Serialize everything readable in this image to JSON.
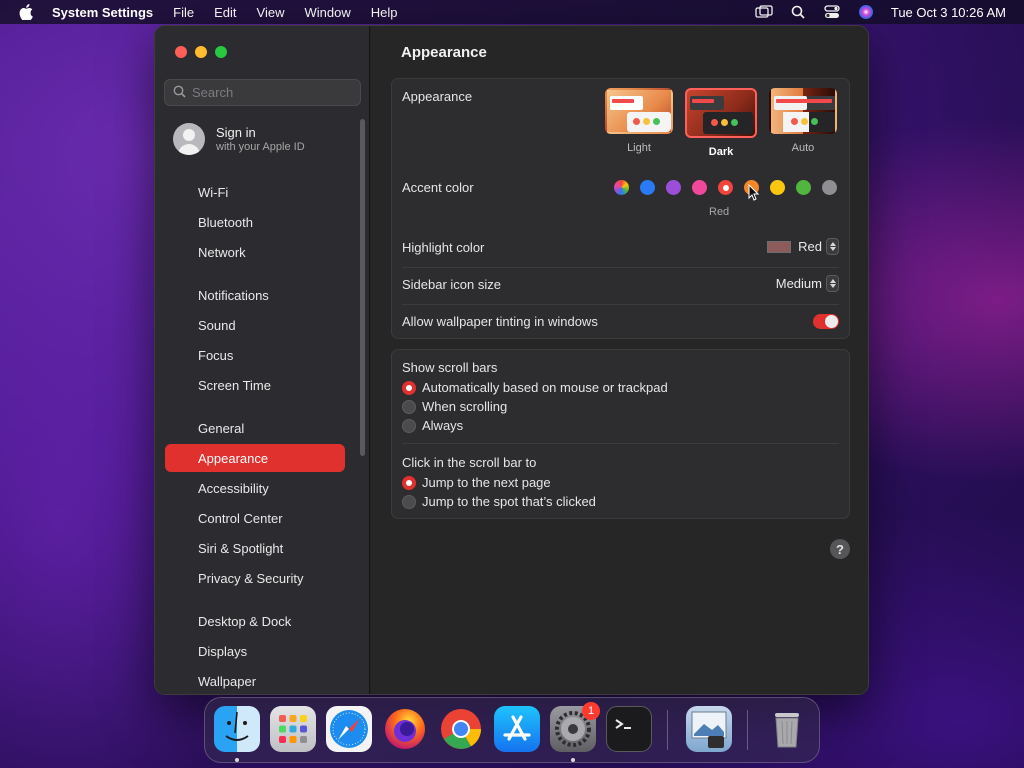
{
  "menubar": {
    "app_name": "System Settings",
    "items": [
      "File",
      "Edit",
      "View",
      "Window",
      "Help"
    ],
    "clock": "Tue Oct 3   10:26 AM"
  },
  "sidebar": {
    "search_placeholder": "Search",
    "signin_title": "Sign in",
    "signin_subtitle": "with your Apple ID",
    "items": [
      {
        "label": "Wi-Fi",
        "icon": "wifi-icon",
        "color": "#2f7cf6"
      },
      {
        "label": "Bluetooth",
        "icon": "bluetooth-icon",
        "color": "#2f7cf6"
      },
      {
        "label": "Network",
        "icon": "globe-icon",
        "color": "#2f7cf6"
      },
      {
        "label": "Notifications",
        "icon": "bell-icon",
        "color": "#ef3b3b"
      },
      {
        "label": "Sound",
        "icon": "speaker-icon",
        "color": "#ef3b6b"
      },
      {
        "label": "Focus",
        "icon": "moon-icon",
        "color": "#6a4cd8"
      },
      {
        "label": "Screen Time",
        "icon": "hourglass-icon",
        "color": "#6a4cd8"
      },
      {
        "label": "General",
        "icon": "gear-icon",
        "color": "#8e8e93"
      },
      {
        "label": "Appearance",
        "icon": "appearance-icon",
        "color": "#1c1c1e"
      },
      {
        "label": "Accessibility",
        "icon": "accessibility-icon",
        "color": "#2f7cf6"
      },
      {
        "label": "Control Center",
        "icon": "control-center-icon",
        "color": "#8e8e93"
      },
      {
        "label": "Siri & Spotlight",
        "icon": "siri-icon",
        "color": "#c13dd8"
      },
      {
        "label": "Privacy & Security",
        "icon": "hand-icon",
        "color": "#2f7cf6"
      },
      {
        "label": "Desktop & Dock",
        "icon": "dock-icon",
        "color": "#1c1c1e"
      },
      {
        "label": "Displays",
        "icon": "display-icon",
        "color": "#2f7cf6"
      },
      {
        "label": "Wallpaper",
        "icon": "wallpaper-icon",
        "color": "#35a7e8"
      }
    ],
    "selected_index": 8
  },
  "content": {
    "title": "Appearance",
    "appearance": {
      "label": "Appearance",
      "options": [
        "Light",
        "Dark",
        "Auto"
      ],
      "selected": "Dark"
    },
    "accent": {
      "label": "Accent color",
      "colors": [
        "multicolor",
        "#2b7af5",
        "#9b4fd8",
        "#f0489a",
        "#f2433d",
        "#f5872b",
        "#f9c80e",
        "#52b540",
        "#8e8e93"
      ],
      "selected_index": 4,
      "selected_name": "Red"
    },
    "highlight": {
      "label": "Highlight color",
      "value": "Red",
      "swatch_color": "#8e5b5d"
    },
    "sidebar_icon_size": {
      "label": "Sidebar icon size",
      "value": "Medium"
    },
    "wallpaper_tinting": {
      "label": "Allow wallpaper tinting in windows",
      "on": true
    },
    "scroll_bars": {
      "label": "Show scroll bars",
      "options": [
        "Automatically based on mouse or trackpad",
        "When scrolling",
        "Always"
      ],
      "selected_index": 0
    },
    "click_scroll": {
      "label": "Click in the scroll bar to",
      "options": [
        "Jump to the next page",
        "Jump to the spot that’s clicked"
      ],
      "selected_index": 0
    },
    "help": "?"
  },
  "dock": {
    "apps": [
      "finder-icon",
      "launchpad-icon",
      "safari-icon",
      "firefox-icon",
      "chrome-icon",
      "app-store-icon",
      "system-settings-icon",
      "terminal-icon",
      "preview-icon",
      "trash-icon"
    ],
    "settings_badge": "1"
  },
  "colors": {
    "accent": "#e0312e"
  }
}
